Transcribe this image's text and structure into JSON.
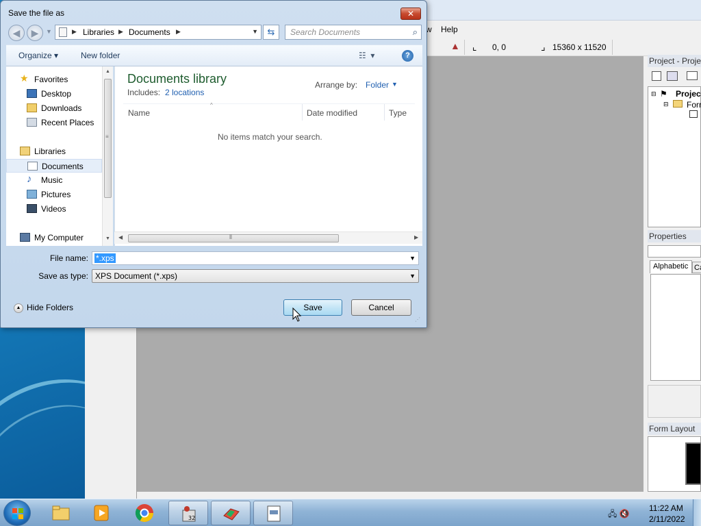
{
  "dialog": {
    "title": "Save the file as",
    "close_label": "✕",
    "address": {
      "crumbs": [
        "Libraries",
        "Documents"
      ]
    },
    "search_placeholder": "Search Documents",
    "commands": {
      "organize": "Organize",
      "new_folder": "New folder"
    },
    "nav_pane": {
      "favorites_header": "Favorites",
      "favorites": [
        "Desktop",
        "Downloads",
        "Recent Places"
      ],
      "libraries_header": "Libraries",
      "libraries": [
        "Documents",
        "Music",
        "Pictures",
        "Videos"
      ],
      "computer": "My Computer",
      "selected": "Documents"
    },
    "content": {
      "title": "Documents library",
      "includes_label": "Includes:",
      "includes_link": "2 locations",
      "arrange_label": "Arrange by:",
      "arrange_value": "Folder",
      "columns": [
        "Name",
        "Date modified",
        "Type"
      ],
      "empty_message": "No items match your search."
    },
    "file_name_label": "File name:",
    "file_name_value": "*.xps",
    "save_type_label": "Save as type:",
    "save_type_value": "XPS Document (*.xps)",
    "hide_folders": "Hide Folders",
    "save_button": "Save",
    "cancel_button": "Cancel"
  },
  "ide": {
    "menu": {
      "partial": "w",
      "help": "Help"
    },
    "toolbar": {
      "position": "0, 0",
      "size": "15360 x 11520"
    },
    "project_title": "Project - Proje",
    "tree": {
      "root": "Projec",
      "child": "Forr"
    },
    "properties_title": "Properties",
    "properties_tabs": [
      "Alphabetic",
      "Ca"
    ],
    "form_layout_title": "Form Layout"
  },
  "taskbar": {
    "time": "11:22 AM",
    "date": "2/11/2022"
  }
}
